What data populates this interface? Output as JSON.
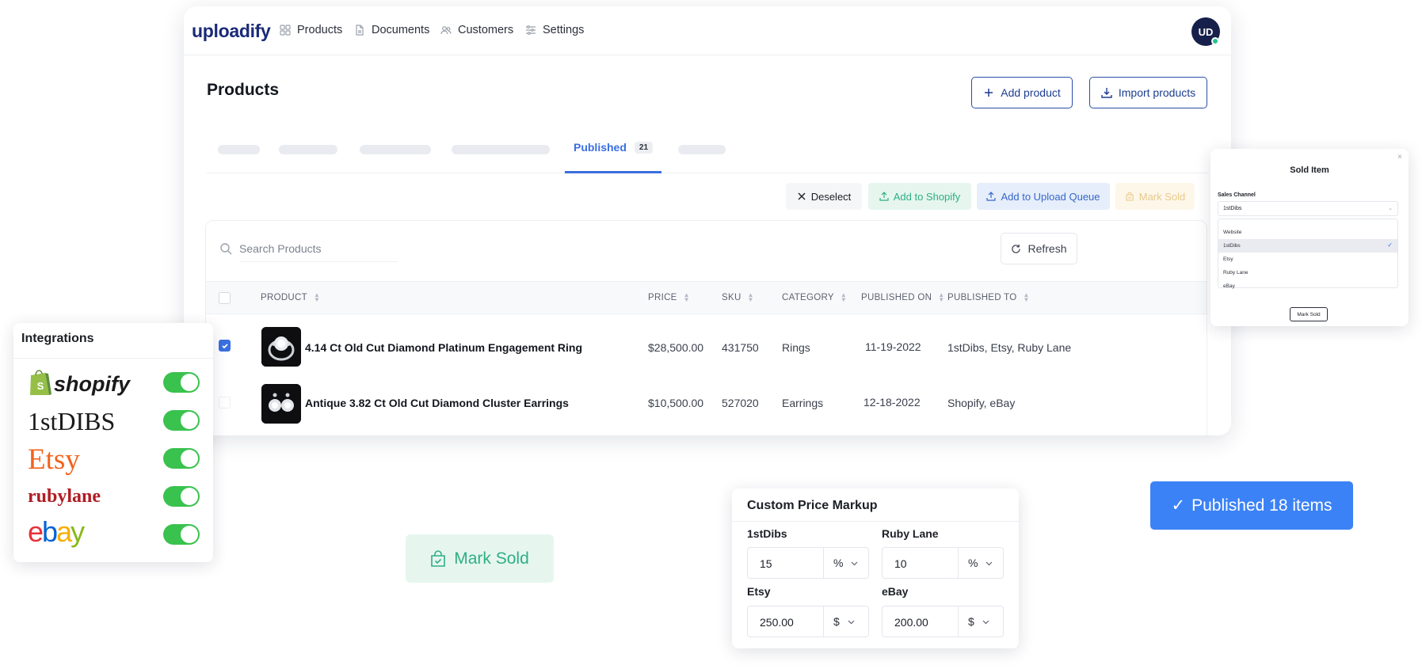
{
  "app": {
    "logo": "uploadify",
    "nav": [
      {
        "label": "Products",
        "icon": "grid-icon"
      },
      {
        "label": "Documents",
        "icon": "document-icon"
      },
      {
        "label": "Customers",
        "icon": "users-icon"
      },
      {
        "label": "Settings",
        "icon": "sliders-icon"
      }
    ],
    "avatar_initials": "UD",
    "page_title": "Products",
    "add_product_label": "Add product",
    "import_products_label": "Import products",
    "active_tab": {
      "label": "Published",
      "count": "21"
    },
    "actions": {
      "deselect": "Deselect",
      "add_to_shopify": "Add to Shopify",
      "add_to_upload_queue": "Add to Upload Queue",
      "mark_sold": "Mark Sold"
    },
    "search": {
      "placeholder": "Search Products",
      "value": ""
    },
    "refresh_label": "Refresh",
    "table": {
      "headers": [
        "PRODUCT",
        "PRICE",
        "SKU",
        "CATEGORY",
        "PUBLISHED ON",
        "PUBLISHED TO"
      ],
      "rows": [
        {
          "checked": true,
          "name": "4.14 Ct Old Cut Diamond Platinum Engagement Ring",
          "price": "$28,500.00",
          "sku": "431750",
          "category": "Rings",
          "published_on": "11-19-2022",
          "published_to": "1stDibs, Etsy, Ruby Lane"
        },
        {
          "checked": false,
          "name": "Antique 3.82 Ct Old Cut Diamond Cluster Earrings",
          "price": "$10,500.00",
          "sku": "527020",
          "category": "Earrings",
          "published_on": "12-18-2022",
          "published_to": "Shopify, eBay"
        }
      ]
    }
  },
  "sold_modal": {
    "title": "Sold Item",
    "close": "×",
    "field_label": "Sales Channel",
    "selected": "1stDibs",
    "options": [
      "Website",
      "1stDibs",
      "Etsy",
      "Ruby Lane",
      "eBay"
    ],
    "button": "Mark Sold"
  },
  "integrations": {
    "title": "Integrations",
    "items": [
      {
        "name": "shopify",
        "enabled": true
      },
      {
        "name": "1stDIBS",
        "enabled": true
      },
      {
        "name": "Etsy",
        "enabled": true
      },
      {
        "name": "rubylane",
        "enabled": true
      },
      {
        "name": "ebay",
        "enabled": true
      }
    ]
  },
  "mark_sold_chip": "Mark Sold",
  "price_markup": {
    "title": "Custom Price Markup",
    "fields": [
      {
        "label": "1stDibs",
        "value": "15",
        "unit": "%"
      },
      {
        "label": "Ruby Lane",
        "value": "10",
        "unit": "%"
      },
      {
        "label": "Etsy",
        "value": "250.00",
        "unit": "$"
      },
      {
        "label": "eBay",
        "value": "200.00",
        "unit": "$"
      }
    ]
  },
  "toast": "Published 18 items",
  "colors": {
    "accent": "#3a6fe0",
    "brand": "#1b2a78",
    "success": "#39c24e",
    "mint": "#2fae85",
    "toast": "#3b82f6"
  }
}
